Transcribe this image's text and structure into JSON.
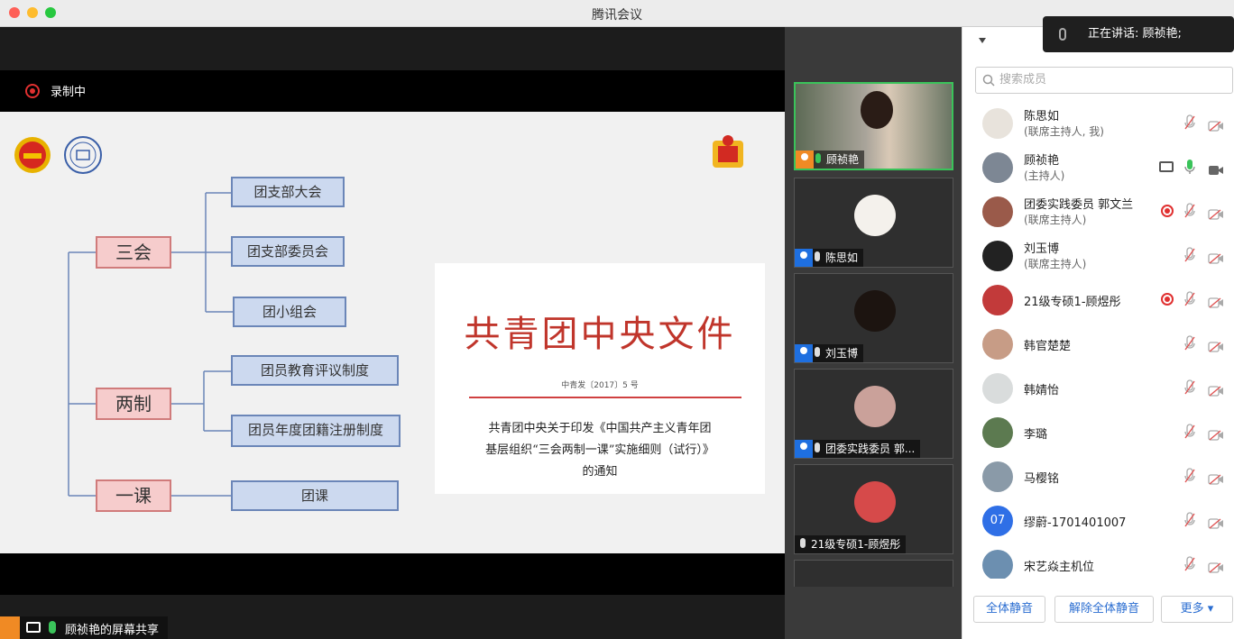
{
  "window": {
    "title": "腾讯会议"
  },
  "recording": {
    "label": "录制中"
  },
  "slide": {
    "tree": {
      "groups": [
        {
          "label": "三会",
          "children": [
            "团支部大会",
            "团支部委员会",
            "团小组会"
          ]
        },
        {
          "label": "两制",
          "children": [
            "团员教育评议制度",
            "团员年度团籍注册制度"
          ]
        },
        {
          "label": "一课",
          "children": [
            "团课"
          ]
        }
      ]
    },
    "document": {
      "title": "共青团中央文件",
      "number": "中青发〔2017〕5 号",
      "body_line1": "共青团中央关于印发《中国共产主义青年团",
      "body_line2": "基层组织“三会两制一课”实施细则（试行）》",
      "body_line3": "的通知"
    }
  },
  "share_bar": {
    "label": "顾祯艳的屏幕共享"
  },
  "video_tiles": [
    {
      "name": "顾祯艳",
      "active": true,
      "avatar_color": "#b08a70"
    },
    {
      "name": "陈思如",
      "active": false,
      "avatar_color": "#f4f1ec"
    },
    {
      "name": "刘玉博",
      "active": false,
      "avatar_color": "#1c1410"
    },
    {
      "name": "团委实践委员 郭...",
      "active": false,
      "avatar_color": "#caa19a"
    },
    {
      "name": "21级专硕1-顾煜彤",
      "active": false,
      "avatar_color": "#d64a4a"
    }
  ],
  "speaking_banner": {
    "text": "正在讲话: 顾祯艳;"
  },
  "members_panel": {
    "search_placeholder": "搜索成员",
    "members": [
      {
        "name": "陈思如",
        "role": "(联席主持人, 我)",
        "avatar_color": "#e8e3dc",
        "recording": false
      },
      {
        "name": "顾祯艳",
        "role": "(主持人)",
        "avatar_color": "#7d8794",
        "recording": false
      },
      {
        "name": "团委实践委员 郭文兰",
        "role": "(联席主持人)",
        "avatar_color": "#9a5a4a",
        "recording": true
      },
      {
        "name": "刘玉博",
        "role": "(联席主持人)",
        "avatar_color": "#222222",
        "recording": false
      },
      {
        "name": "21级专硕1-顾煜彤",
        "role": "",
        "avatar_color": "#c23a3a",
        "recording": true
      },
      {
        "name": "韩官楚楚",
        "role": "",
        "avatar_color": "#c79c86",
        "recording": false
      },
      {
        "name": "韩婧怡",
        "role": "",
        "avatar_color": "#d9dcdc",
        "recording": false
      },
      {
        "name": "李璐",
        "role": "",
        "avatar_color": "#5c7a50",
        "recording": false
      },
      {
        "name": "马樱铭",
        "role": "",
        "avatar_color": "#8a9aa8",
        "recording": false
      },
      {
        "name": "缪蔚-1701401007",
        "role": "",
        "avatar_text": "07",
        "avatar_color": "#2f6fe6",
        "recording": false
      },
      {
        "name": "宋艺焱主机位",
        "role": "",
        "avatar_color": "#6c8fb0",
        "recording": false
      }
    ],
    "buttons": {
      "mute_all": "全体静音",
      "unmute_all": "解除全体静音",
      "more": "更多 ▾"
    }
  },
  "colors": {
    "active_green": "#3ac35a",
    "accent_blue": "#2a6dd1",
    "doc_red": "#c0352b"
  }
}
